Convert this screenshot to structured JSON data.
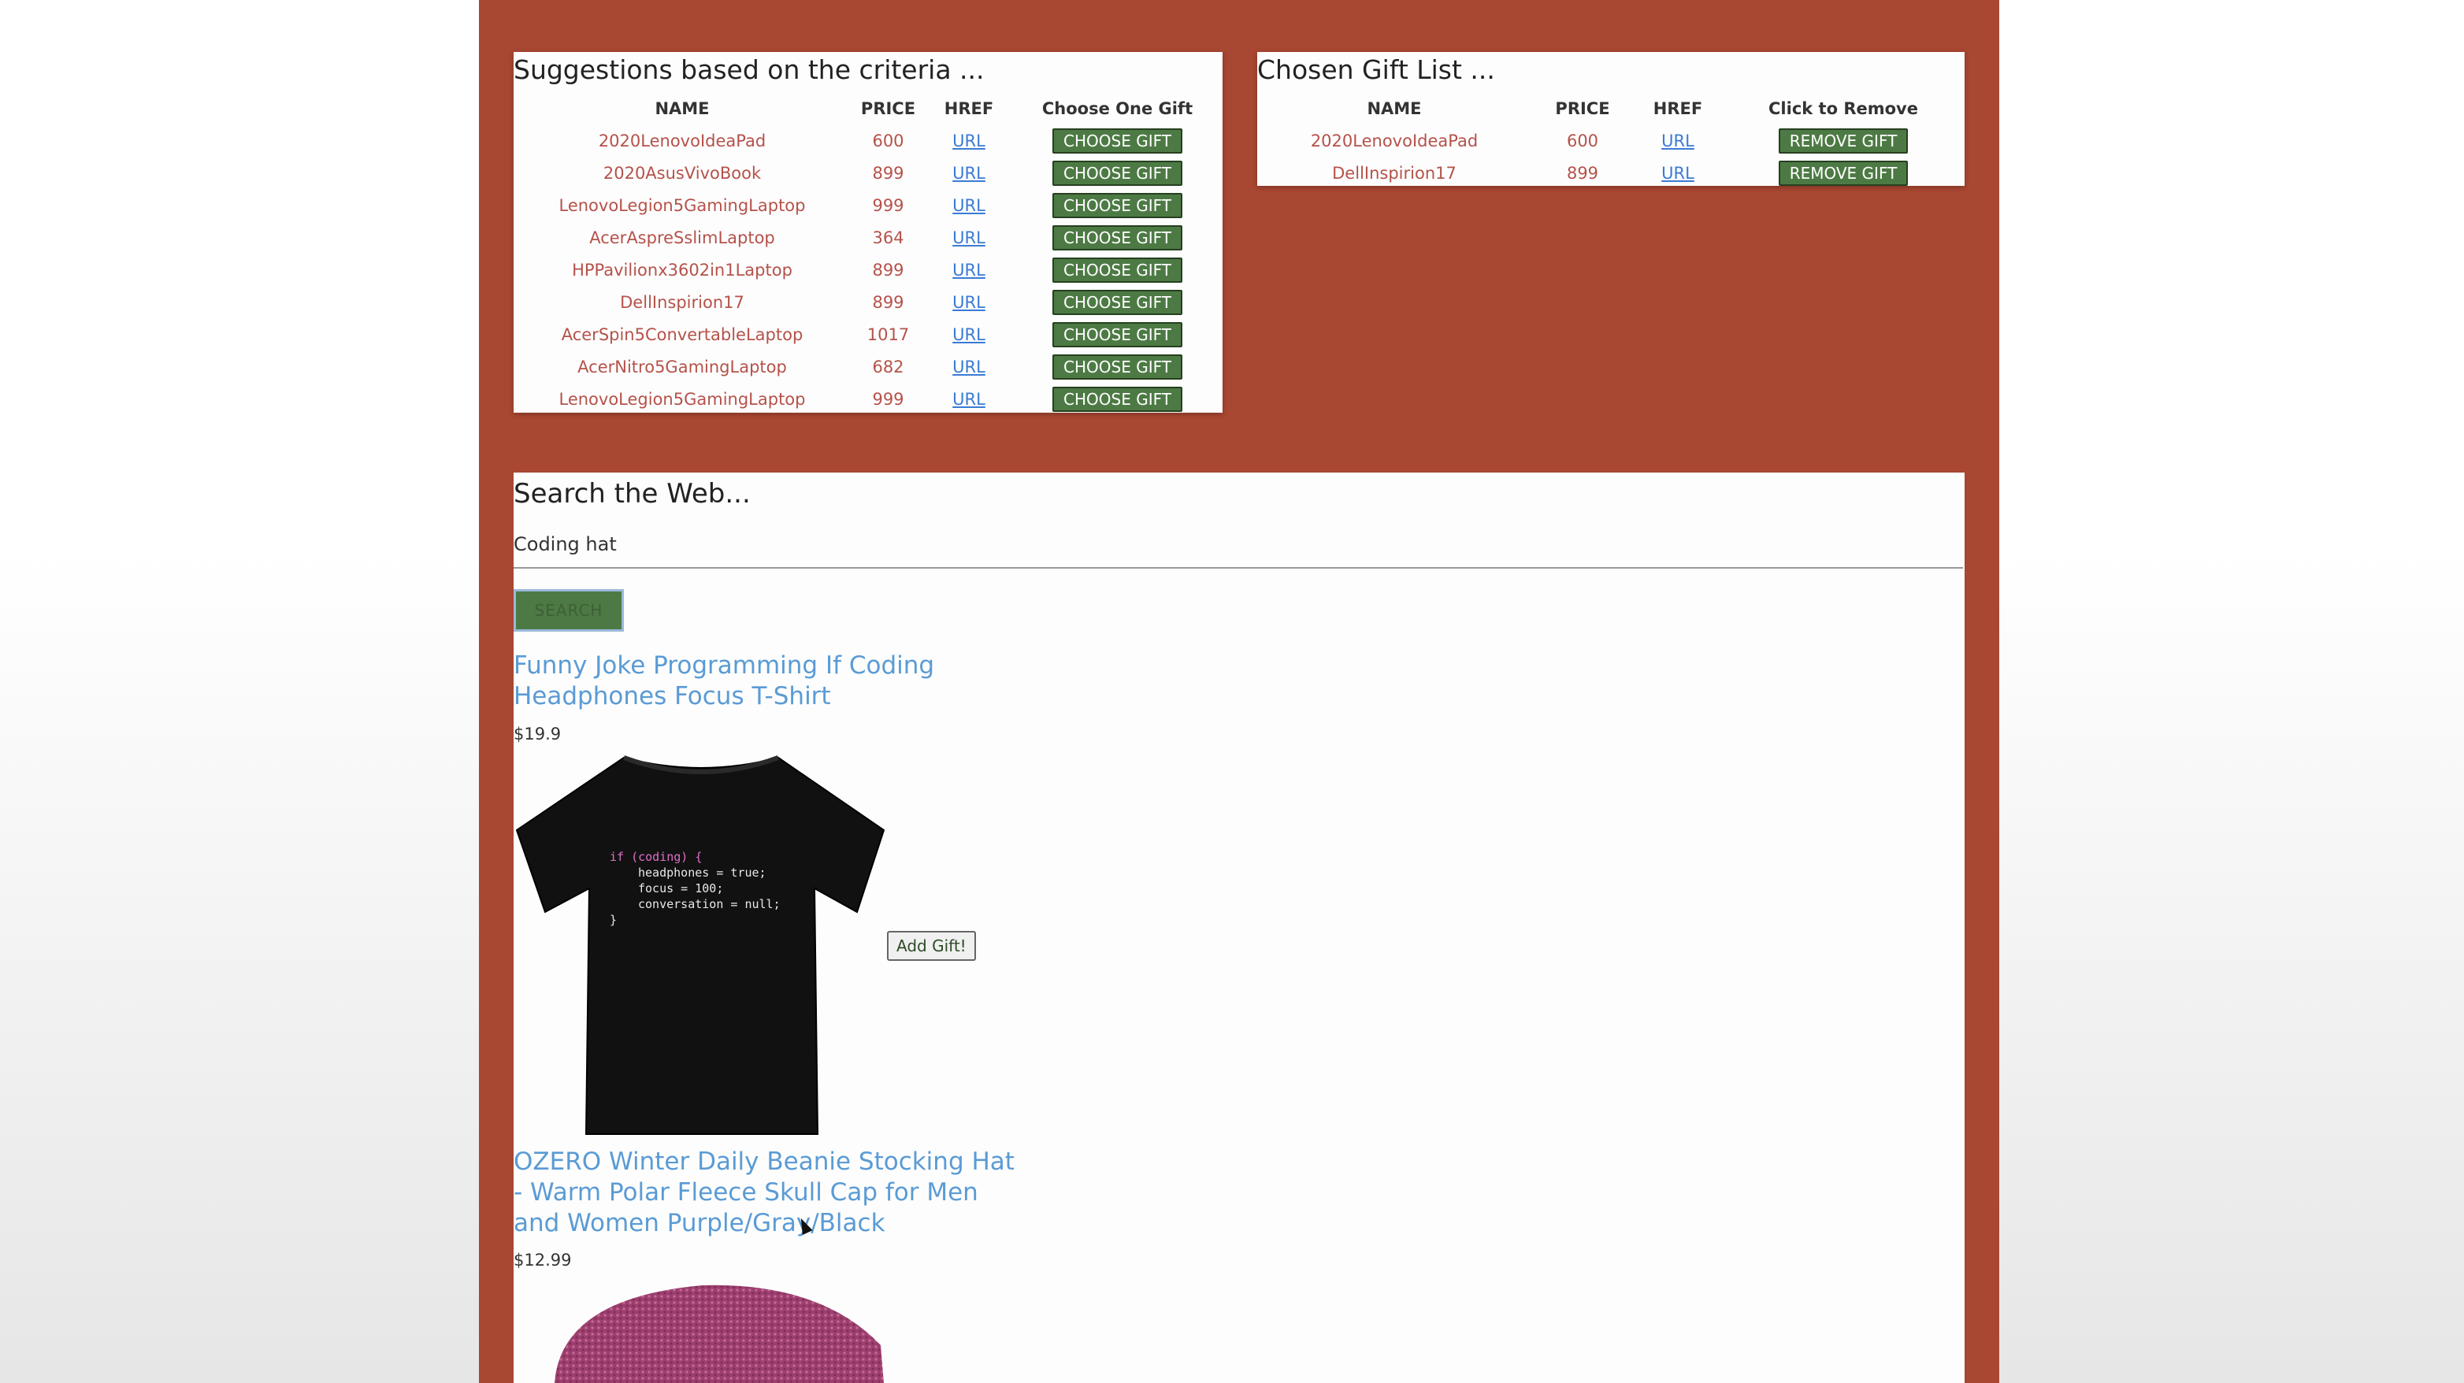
{
  "suggestions": {
    "title": "Suggestions based on the criteria ...",
    "headers": [
      "NAME",
      "PRICE",
      "HREF",
      "Choose One Gift"
    ],
    "button_label": "CHOOSE GIFT",
    "rows": [
      {
        "name": "2020LenovoIdeaPad",
        "price": "600",
        "href": "URL"
      },
      {
        "name": "2020AsusVivoBook",
        "price": "899",
        "href": "URL"
      },
      {
        "name": "LenovoLegion5GamingLaptop",
        "price": "999",
        "href": "URL"
      },
      {
        "name": "AcerAspreSslimLaptop",
        "price": "364",
        "href": "URL"
      },
      {
        "name": "HPPavilionx3602in1Laptop",
        "price": "899",
        "href": "URL"
      },
      {
        "name": "DellInspirion17",
        "price": "899",
        "href": "URL"
      },
      {
        "name": "AcerSpin5ConvertableLaptop",
        "price": "1017",
        "href": "URL"
      },
      {
        "name": "AcerNitro5GamingLaptop",
        "price": "682",
        "href": "URL"
      },
      {
        "name": "LenovoLegion5GamingLaptop",
        "price": "999",
        "href": "URL"
      }
    ]
  },
  "chosen": {
    "title": "Chosen Gift List ...",
    "headers": [
      "NAME",
      "PRICE",
      "HREF",
      "Click to Remove"
    ],
    "button_label": "REMOVE GIFT",
    "rows": [
      {
        "name": "2020LenovoIdeaPad",
        "price": "600",
        "href": "URL"
      },
      {
        "name": "DellInspirion17",
        "price": "899",
        "href": "URL"
      }
    ]
  },
  "search": {
    "title": "Search the Web...",
    "query": "Coding hat",
    "button_label": "SEARCH"
  },
  "results": [
    {
      "title_line1": "Funny Joke Programming If Coding",
      "title_line2": "Headphones Focus T-Shirt",
      "price": "$19.9",
      "add_label": "Add Gift!",
      "shirt_code": [
        "if (coding) {",
        "headphones = true;",
        "focus = 100;",
        "conversation = null;",
        "}"
      ]
    },
    {
      "title_line1": "OZERO Winter Daily Beanie Stocking Hat",
      "title_line2": "- Warm Polar Fleece Skull Cap for Men",
      "title_line3": "and Women Purple/Gray/Black",
      "price": "$12.99"
    }
  ]
}
